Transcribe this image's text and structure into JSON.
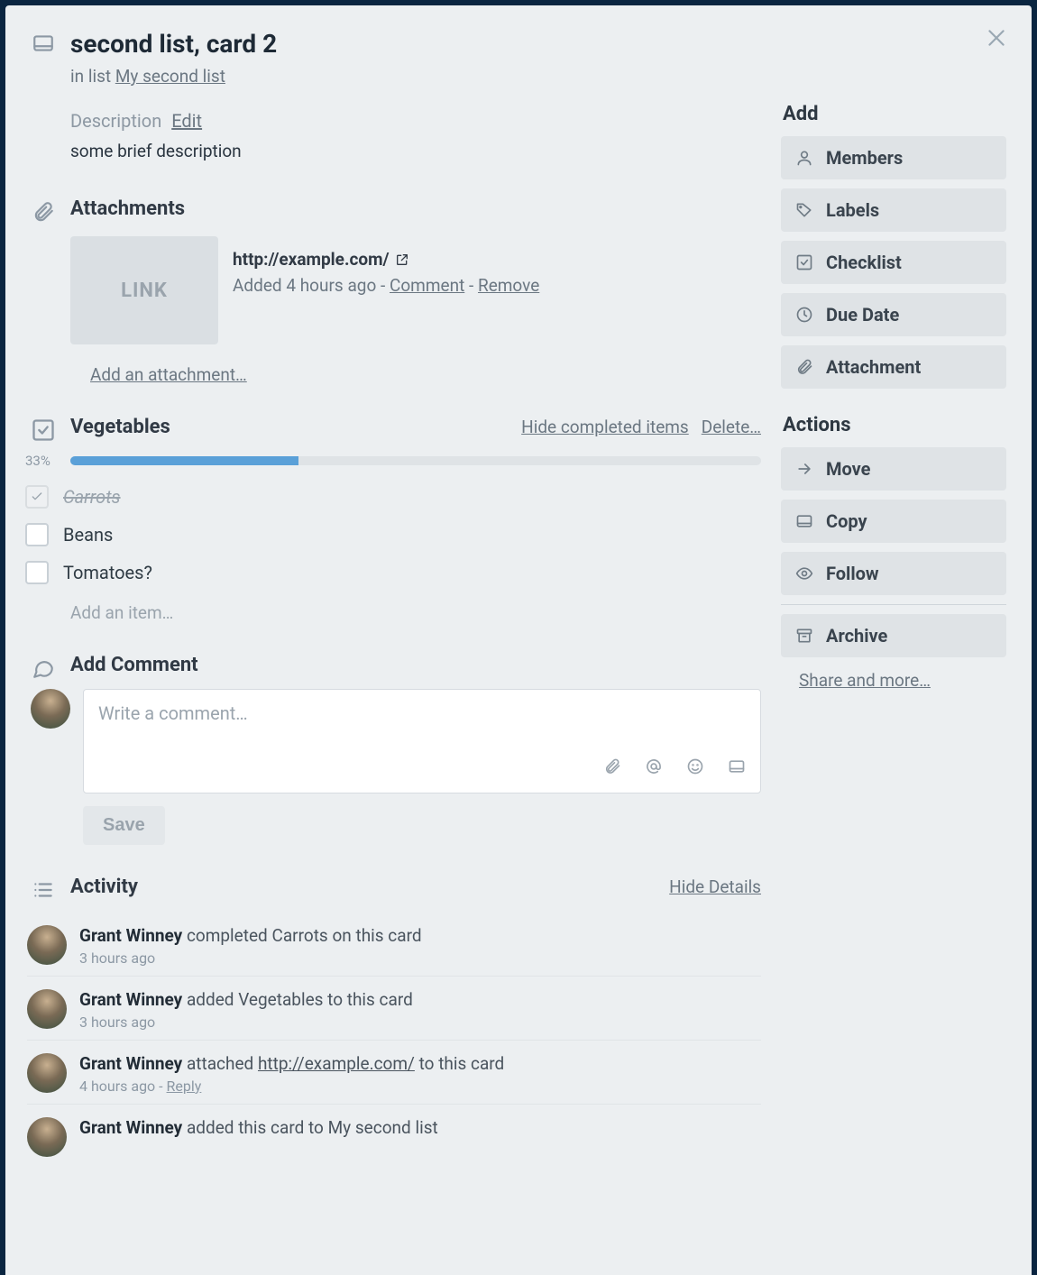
{
  "card": {
    "title": "second list, card 2",
    "in_list_prefix": "in list ",
    "in_list_link": "My second list"
  },
  "description": {
    "label": "Description",
    "edit": "Edit",
    "text": "some brief description"
  },
  "attachments": {
    "title": "Attachments",
    "items": [
      {
        "thumb": "LINK",
        "url": "http://example.com/",
        "added": "Added 4 hours ago",
        "sep1": " - ",
        "comment": "Comment",
        "sep2": " - ",
        "remove": "Remove"
      }
    ],
    "add": "Add an attachment…"
  },
  "checklist": {
    "title": "Vegetables",
    "hide": "Hide completed items",
    "delete": "Delete…",
    "percent": "33%",
    "percent_value": 33,
    "items": [
      {
        "label": "Carrots",
        "checked": true
      },
      {
        "label": "Beans",
        "checked": false
      },
      {
        "label": "Tomatoes?",
        "checked": false
      }
    ],
    "add_item": "Add an item…"
  },
  "comment": {
    "title": "Add Comment",
    "placeholder": "Write a comment…",
    "save": "Save"
  },
  "activity": {
    "title": "Activity",
    "hide": "Hide Details",
    "items": [
      {
        "user": "Grant Winney",
        "action": " completed Carrots on this card",
        "time": "3 hours ago",
        "reply": ""
      },
      {
        "user": "Grant Winney",
        "action": " added Vegetables to this card",
        "time": "3 hours ago",
        "reply": ""
      },
      {
        "user": "Grant Winney",
        "action_pre": " attached ",
        "link": "http://example.com/",
        "action_post": " to this card",
        "time": "4 hours ago",
        "reply": "Reply"
      },
      {
        "user": "Grant Winney",
        "action": " added this card to My second list",
        "time": "",
        "reply": ""
      }
    ]
  },
  "sidebar": {
    "add_title": "Add",
    "add": [
      {
        "label": "Members",
        "icon": "user"
      },
      {
        "label": "Labels",
        "icon": "tag"
      },
      {
        "label": "Checklist",
        "icon": "check-square"
      },
      {
        "label": "Due Date",
        "icon": "clock"
      },
      {
        "label": "Attachment",
        "icon": "paperclip"
      }
    ],
    "actions_title": "Actions",
    "actions": [
      {
        "label": "Move",
        "icon": "arrow-right"
      },
      {
        "label": "Copy",
        "icon": "card"
      },
      {
        "label": "Follow",
        "icon": "eye"
      },
      {
        "label": "Archive",
        "icon": "archive"
      }
    ],
    "share": "Share and more…"
  }
}
